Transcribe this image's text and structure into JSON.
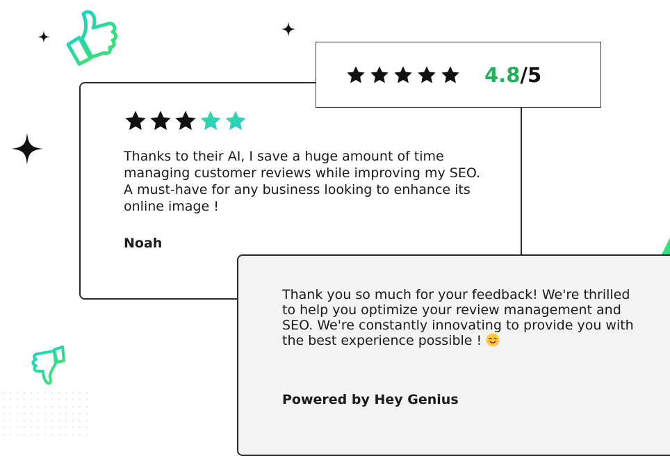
{
  "colors": {
    "accent_green": "#22b35a",
    "star_gradient_start": "#3ddc84",
    "star_gradient_end": "#1ecbe1",
    "star_dark": "#111111",
    "card_border": "#2a2a2a",
    "reply_background": "#f3f3f4"
  },
  "overall_rating": {
    "stars": 5,
    "value": "4.8",
    "suffix": "/5"
  },
  "review": {
    "stars_filled": 3,
    "stars_total": 5,
    "text": "Thanks to their AI, I save a huge amount of time managing customer reviews while improving my SEO. A must-have for any business looking to enhance its online image !",
    "author": "Noah"
  },
  "reply": {
    "text": "Thank you so much for your feedback! We're thrilled to help you optimize your review management and SEO. We're constantly innovating to provide you with the best experience possible !",
    "emoji_icon": "smiling-face-icon",
    "powered_by": "Powered by Hey Genius"
  },
  "decorations": {
    "thumb_up_icon": "thumbs-up-icon",
    "thumb_down_icon": "thumbs-down-icon",
    "sparkle_icon": "sparkle-icon"
  }
}
